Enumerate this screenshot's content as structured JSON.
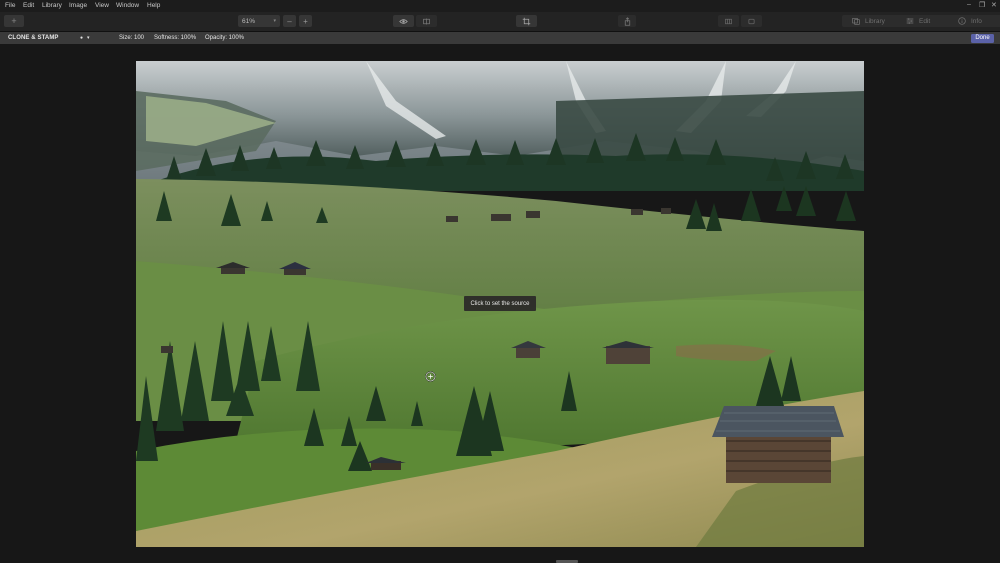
{
  "menu": [
    "File",
    "Edit",
    "Library",
    "Image",
    "View",
    "Window",
    "Help"
  ],
  "window_controls": {
    "minimize": "–",
    "restore": "❐",
    "close": "✕"
  },
  "toolbar": {
    "add_label": "+",
    "zoom_value": "61%",
    "zoom_out_label": "–",
    "zoom_in_label": "+",
    "library_label": "Library",
    "edit_label": "Edit",
    "info_label": "Info"
  },
  "tool_options": {
    "tool_name": "CLONE & STAMP",
    "size": "Size: 100",
    "softness": "Softness: 100%",
    "opacity": "Opacity: 100%",
    "done_label": "Done"
  },
  "canvas": {
    "tooltip": "Click to set the source"
  },
  "colors": {
    "accent": "#5b62a8",
    "background": "#171717",
    "toolbar": "#232323",
    "options_bar": "#3a3a3a"
  },
  "icons": [
    "plus-icon",
    "chevron-down-icon",
    "minus-icon",
    "eye-icon",
    "compare-icon",
    "crop-icon",
    "share-icon",
    "grid-view-icon",
    "single-view-icon",
    "library-icon",
    "sliders-icon",
    "info-icon",
    "clone-brush-cursor-icon"
  ]
}
